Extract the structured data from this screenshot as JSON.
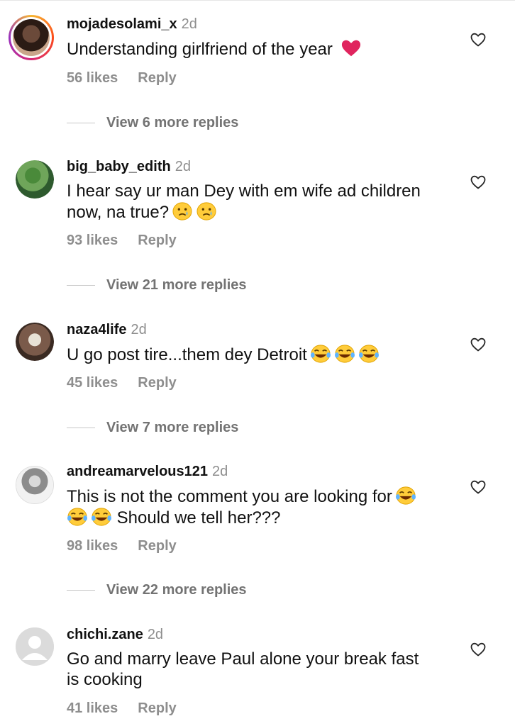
{
  "comments": [
    {
      "username": "mojadesolami_x",
      "time": "2d",
      "text": "Understanding girlfriend of the year",
      "emoji": [
        "heart"
      ],
      "likes": "56 likes",
      "reply": "Reply",
      "view_replies": "View 6 more replies"
    },
    {
      "username": "big_baby_edith",
      "time": "2d",
      "text_line1": "I hear say ur man Dey with em wife ad children",
      "text_line2": "now, na true?",
      "emoji": [
        "crying-face",
        "crying-face"
      ],
      "likes": "93 likes",
      "reply": "Reply",
      "view_replies": "View 21 more replies"
    },
    {
      "username": "naza4life",
      "time": "2d",
      "text": "U go post tire...them dey Detroit",
      "emoji": [
        "tears-of-joy",
        "tears-of-joy",
        "tears-of-joy"
      ],
      "likes": "45 likes",
      "reply": "Reply",
      "view_replies": "View 7 more replies"
    },
    {
      "username": "andreamarvelous121",
      "time": "2d",
      "text_line1": "This is not the comment you are looking for",
      "text_line2": "Should we tell her???",
      "emoji": [
        "tears-of-joy",
        "tears-of-joy",
        "tears-of-joy"
      ],
      "likes": "98 likes",
      "reply": "Reply",
      "view_replies": "View 22 more replies"
    },
    {
      "username": "chichi.zane",
      "time": "2d",
      "text_line1": "Go and marry leave Paul alone your break fast",
      "text_line2": "is cooking",
      "likes": "41 likes",
      "reply": "Reply"
    }
  ],
  "colors": {
    "text": "#111111",
    "muted": "#8e8e8e",
    "heart_red": "#e0245e",
    "emoji_yellow": "#ffcc3a"
  },
  "icons": {
    "like": "heart-outline-icon"
  }
}
